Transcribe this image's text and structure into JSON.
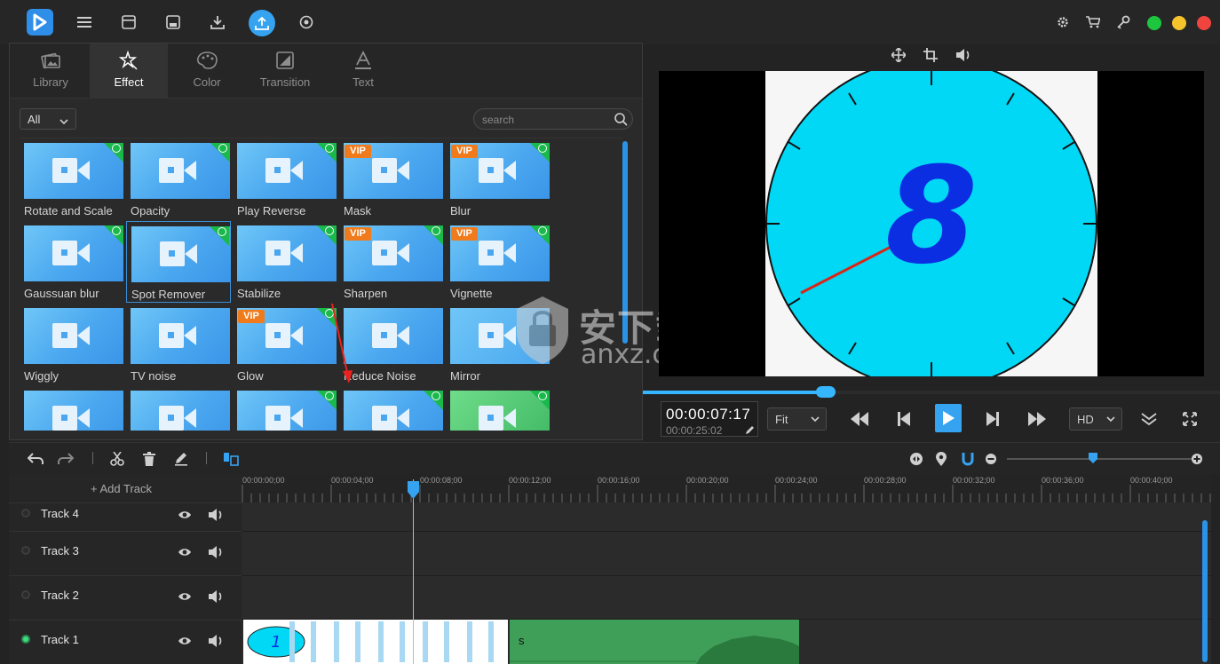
{
  "tabs": [
    {
      "label": "Library",
      "icon": "library-icon"
    },
    {
      "label": "Effect",
      "icon": "effect-icon"
    },
    {
      "label": "Color",
      "icon": "palette-icon"
    },
    {
      "label": "Transition",
      "icon": "transition-icon"
    },
    {
      "label": "Text",
      "icon": "text-icon"
    }
  ],
  "active_tab": "Effect",
  "filter": {
    "value": "All"
  },
  "search": {
    "placeholder": "search"
  },
  "effects": [
    {
      "label": "Rotate and Scale",
      "vip": false,
      "free": true
    },
    {
      "label": "Opacity",
      "vip": false,
      "free": true
    },
    {
      "label": "Play Reverse",
      "vip": false,
      "free": true
    },
    {
      "label": "Mask",
      "vip": true,
      "free": false
    },
    {
      "label": "Blur",
      "vip": true,
      "free": true
    },
    {
      "label": "Gaussuan blur",
      "vip": false,
      "free": true
    },
    {
      "label": "Spot Remover",
      "vip": false,
      "free": true,
      "selected": true
    },
    {
      "label": "Stabilize",
      "vip": false,
      "free": true
    },
    {
      "label": "Sharpen",
      "vip": true,
      "free": true
    },
    {
      "label": "Vignette",
      "vip": true,
      "free": true
    },
    {
      "label": "Wiggly",
      "vip": false,
      "free": false
    },
    {
      "label": "TV noise",
      "vip": false,
      "free": false
    },
    {
      "label": "Glow",
      "vip": true,
      "free": true
    },
    {
      "label": "Reduce Noise",
      "vip": false,
      "free": false
    },
    {
      "label": "Mirror",
      "vip": false,
      "free": false
    },
    {
      "label": "",
      "vip": false,
      "free": false
    },
    {
      "label": "",
      "vip": false,
      "free": false
    },
    {
      "label": "",
      "vip": false,
      "free": true
    },
    {
      "label": "",
      "vip": false,
      "free": true
    },
    {
      "label": "",
      "vip": false,
      "free": true
    }
  ],
  "vip_label": "VIP",
  "player": {
    "current_time": "00:00:07:17",
    "total_time": "00:00:25:02",
    "fit": "Fit",
    "quality": "HD",
    "progress": 0.31,
    "preview_digit": "8"
  },
  "timeline": {
    "add_track_label": "+ Add Track",
    "ticks": [
      "00:00:00;00",
      "00:00:04;00",
      "00:00:08;00",
      "00:00:12;00",
      "00:00:16;00",
      "00:00:20;00",
      "00:00:24;00",
      "00:00:28;00",
      "00:00:32;00",
      "00:00:36;00",
      "00:00:40;00"
    ],
    "tracks": [
      {
        "name": "Track 4",
        "active": false
      },
      {
        "name": "Track 3",
        "active": false
      },
      {
        "name": "Track 2",
        "active": false
      },
      {
        "name": "Track 1",
        "active": true
      }
    ],
    "audio_clip_label": "s"
  },
  "watermark": {
    "title": "安下载",
    "sub": "anxz.com"
  },
  "colors": {
    "accent": "#36b6ff",
    "free_badge": "#19b94c",
    "vip_badge": "#f07b1d",
    "clock_face": "#00d8f5"
  }
}
